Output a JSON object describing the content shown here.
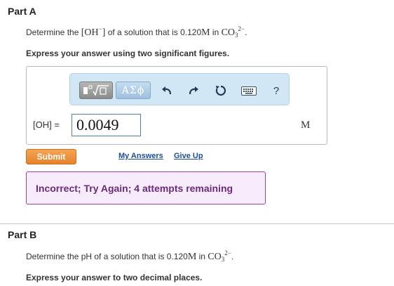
{
  "part_a": {
    "title": "Part A",
    "question_prefix": "Determine the ",
    "species_base": "OH",
    "species_charge": "−",
    "question_middle": " of a solution that is 0.120",
    "question_unit": "M",
    "question_in": " in ",
    "solute_base": "CO",
    "solute_sub": "3",
    "solute_charge": "2−",
    "question_end": ".",
    "instruction": "Express your answer using two significant figures.",
    "toolbar": {
      "template_icon": "template-icon",
      "symbols_label": "ΑΣϕ",
      "undo_icon": "undo-icon",
      "redo_icon": "redo-icon",
      "reset_icon": "reset-icon",
      "keyboard_icon": "keyboard-icon",
      "help_label": "?"
    },
    "answer_label": "[OH] =",
    "answer_value": "0.0049",
    "answer_unit": "M",
    "submit_label": "Submit",
    "my_answers_label": "My Answers",
    "give_up_label": "Give Up",
    "feedback": "Incorrect; Try Again; 4 attempts remaining"
  },
  "part_b": {
    "title": "Part B",
    "question_prefix": "Determine the pH of a solution that is 0.120",
    "question_unit": "M",
    "question_in": " in ",
    "solute_base": "CO",
    "solute_sub": "3",
    "solute_charge": "2−",
    "question_end": ".",
    "instruction": "Express your answer to two decimal places."
  },
  "colors": {
    "submit_orange": "#e98a33",
    "toolbar_blue": "#d1e7f6",
    "feedback_purple": "#6d2a7d",
    "link_blue": "#1a4d9c"
  }
}
